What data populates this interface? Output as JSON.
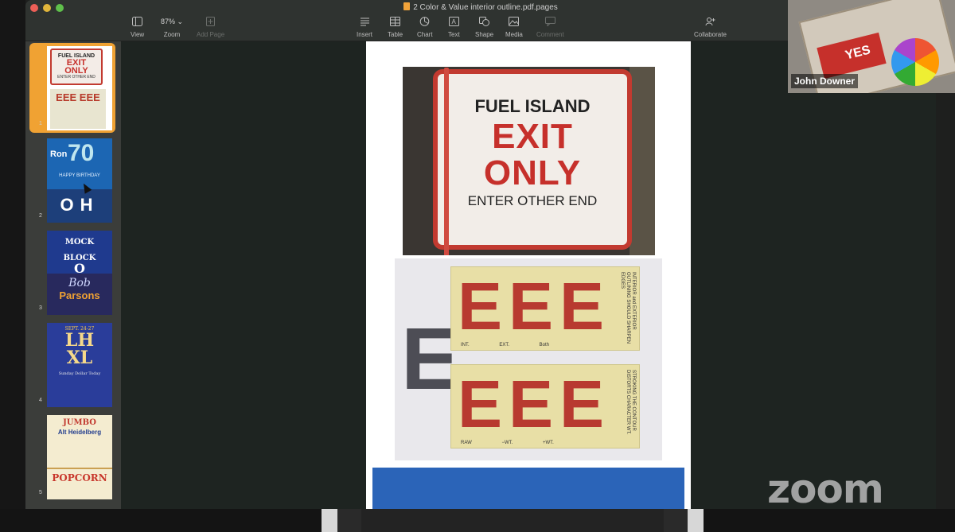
{
  "window": {
    "title": "2 Color & Value interior outline.pdf.pages"
  },
  "toolbar": {
    "view_label": "View",
    "zoom_value": "87%",
    "zoom_label": "Zoom",
    "add_page_label": "Add Page",
    "insert_label": "Insert",
    "table_label": "Table",
    "chart_label": "Chart",
    "text_label": "Text",
    "shape_label": "Shape",
    "media_label": "Media",
    "comment_label": "Comment",
    "collaborate_label": "Collaborate"
  },
  "sidebar": {
    "pages": [
      {
        "number": "1",
        "selected": true
      },
      {
        "number": "2",
        "selected": false
      },
      {
        "number": "3",
        "selected": false
      },
      {
        "number": "4",
        "selected": false
      },
      {
        "number": "5",
        "selected": false
      }
    ],
    "thumb1": {
      "line1": "FUEL ISLAND",
      "line2": "EXIT",
      "line3": "ONLY",
      "line4": "ENTER OTHER END",
      "letters": "EEE EEE"
    },
    "thumb2": {
      "ron": "Ron",
      "age": "70",
      "greeting": "HAPPY BIRTHDAY",
      "letters": "OH"
    },
    "thumb3": {
      "line1": "MOCK",
      "line2": "BLOCK",
      "line3": "O",
      "sig": "Bob",
      "name": "Parsons"
    },
    "thumb4": {
      "date": "SEPT. 24-27",
      "line1": "LH",
      "line2": "XL",
      "sub": "Sunday Dollar Today"
    },
    "thumb5": {
      "line1": "JUMBO",
      "line2": "Alt Heidelberg",
      "line3": "POPCORN"
    }
  },
  "document": {
    "photo1": {
      "line1": "FUEL ISLAND",
      "line2": "EXIT",
      "line3": "ONLY",
      "line4": "ENTER OTHER END"
    },
    "photo2": {
      "card1_letters": "EEE",
      "card1_labels": "INT. EXT. Both",
      "card1_note": "INTERIOR and EXTERIOR OUTLINING SHOULD SHARPEN EDGES",
      "card2_letters": "EEE",
      "card2_labels": "RAW −WT. +WT.",
      "card2_note": "STROKING THE CONTOUR DISTORTS CHARACTER WT.",
      "big_letter": "E"
    }
  },
  "zoom": {
    "participant_name": "John Downer",
    "video_sign_text": "YES",
    "logo": "zoom"
  },
  "colors": {
    "selected_thumb": "#f0a233",
    "sign_red": "#c6302b",
    "canvas_bg": "#1e2421"
  }
}
